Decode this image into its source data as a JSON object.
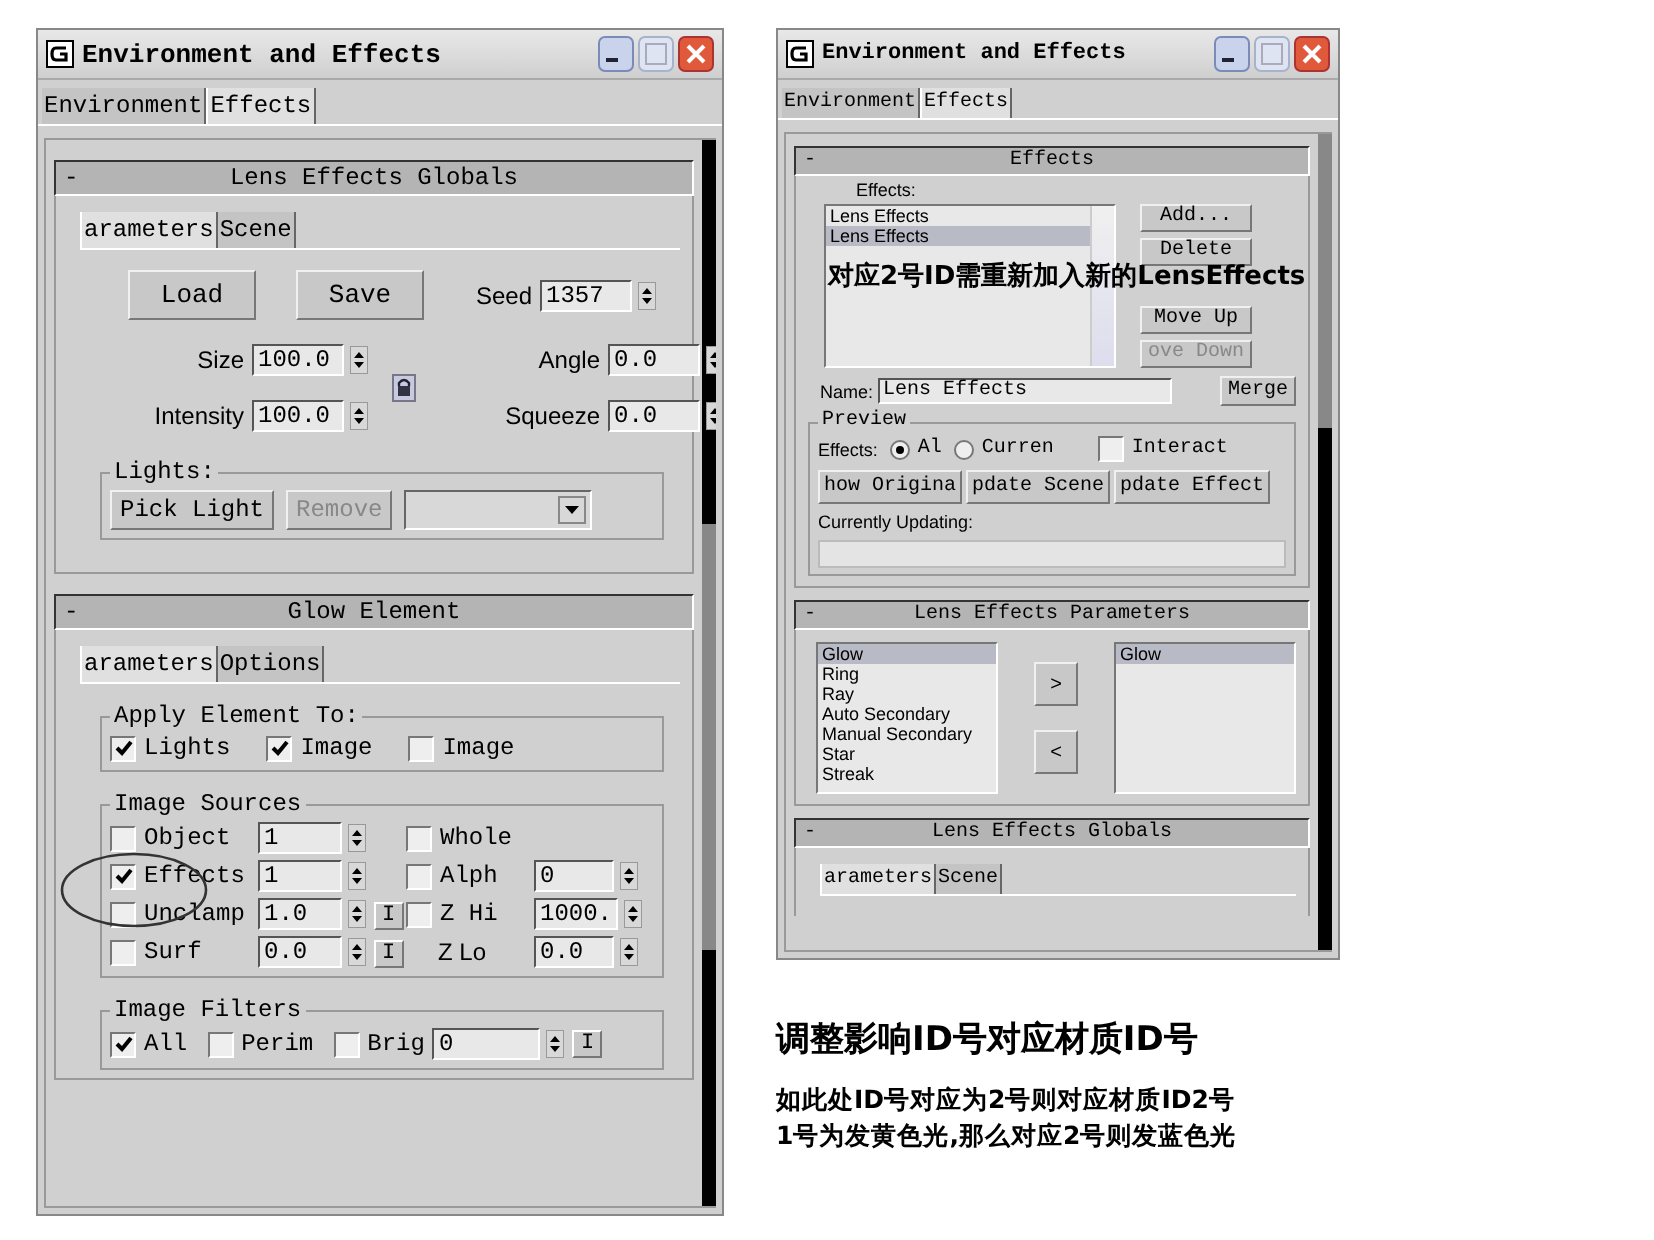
{
  "left_window": {
    "title": "Environment and Effects",
    "tabs": [
      {
        "label": "Environment",
        "selected": false
      },
      {
        "label": "Effects",
        "selected": true
      }
    ],
    "globals": {
      "toggle": "-",
      "title": "Lens Effects Globals",
      "tabs": [
        {
          "label": "arameters",
          "selected": true
        },
        {
          "label": "Scene",
          "selected": false
        }
      ],
      "load_button": "Load",
      "save_button": "Save",
      "seed": {
        "label": "Seed",
        "value": "1357"
      },
      "size": {
        "label": "Size",
        "value": "100.0"
      },
      "angle": {
        "label": "Angle",
        "value": "0.0"
      },
      "intensity": {
        "label": "Intensity",
        "value": "100.0"
      },
      "squeeze": {
        "label": "Squeeze",
        "value": "0.0"
      },
      "lights": {
        "title": "Lights:",
        "pick_button": "Pick Light",
        "remove_button": {
          "label": "Remove",
          "disabled": true
        }
      }
    },
    "glow": {
      "toggle": "-",
      "title": "Glow Element",
      "tabs": [
        {
          "label": "arameters",
          "selected": true
        },
        {
          "label": "Options",
          "selected": false
        }
      ],
      "apply": {
        "title": "Apply Element To:",
        "options": [
          {
            "label": "Lights",
            "checked": true
          },
          {
            "label": "Image",
            "checked": true
          },
          {
            "label": "Image",
            "checked": false
          }
        ]
      },
      "sources": {
        "title": "Image Sources",
        "rows": [
          {
            "label": "Object",
            "checked": false,
            "value": "1",
            "right": {
              "kind": "check",
              "label": "Whole",
              "checked": false
            }
          },
          {
            "label": "Effects",
            "checked": true,
            "value": "1",
            "right": {
              "kind": "check",
              "label": "Alph",
              "checked": false,
              "value": "0"
            }
          },
          {
            "label": "Unclamp",
            "checked": false,
            "value": "1.0",
            "i_button": "I",
            "right": {
              "kind": "check",
              "label": "Z Hi",
              "checked": false,
              "value": "1000."
            }
          },
          {
            "label": "Surf",
            "checked": false,
            "value": "0.0",
            "i_button": "I",
            "right": {
              "kind": "label",
              "label": "Z Lo",
              "value": "0.0"
            }
          }
        ]
      },
      "filters": {
        "title": "Image Filters",
        "options": [
          {
            "label": "All",
            "checked": true
          },
          {
            "label": "Perim",
            "checked": false
          },
          {
            "label": "Brig",
            "checked": false,
            "value": "0",
            "i_button": "I"
          }
        ]
      }
    }
  },
  "right_window": {
    "title": "Environment and Effects",
    "tabs": [
      {
        "label": "Environment",
        "selected": false
      },
      {
        "label": "Effects",
        "selected": true
      }
    ],
    "effects": {
      "toggle": "-",
      "title": "Effects",
      "list_label": "Effects:",
      "items": [
        {
          "label": "Lens Effects",
          "selected": false
        },
        {
          "label": "Lens Effects",
          "selected": true
        }
      ],
      "buttons": [
        {
          "label": "Add...",
          "disabled": false
        },
        {
          "label": "Delete",
          "disabled": false
        },
        {
          "label": "Move Up",
          "disabled": false
        },
        {
          "label": "ove Down",
          "disabled": true
        }
      ],
      "name_label": "Name:",
      "name_value": "Lens Effects",
      "merge_button": "Merge",
      "preview": {
        "title": "Preview",
        "effects_label": "Effects:",
        "radios": [
          {
            "label": "Al",
            "selected": true
          },
          {
            "label": "Curren",
            "selected": false
          }
        ],
        "interact": {
          "label": "Interact",
          "checked": false
        },
        "buttons": [
          "how Origina",
          "pdate Scene",
          "pdate Effect"
        ],
        "updating_label": "Currently Updating:",
        "progress": {
          "level": 0
        }
      }
    },
    "parameters": {
      "toggle": "-",
      "title": "Lens Effects Parameters",
      "available": [
        {
          "label": "Glow",
          "selected": true
        },
        {
          "label": "Ring",
          "selected": false
        },
        {
          "label": "Ray",
          "selected": false
        },
        {
          "label": "Auto Secondary",
          "selected": false
        },
        {
          "label": "Manual Secondary",
          "selected": false
        },
        {
          "label": "Star",
          "selected": false
        },
        {
          "label": "Streak",
          "selected": false
        }
      ],
      "add_button": ">",
      "remove_button": "<",
      "active": [
        {
          "label": "Glow",
          "selected": true
        }
      ]
    },
    "globals": {
      "toggle": "-",
      "title": "Lens Effects Globals",
      "tabs": [
        {
          "label": "arameters",
          "selected": true
        },
        {
          "label": "Scene",
          "selected": false
        }
      ]
    },
    "annotation": "对应2号ID需重新加入新的LensEffects"
  },
  "caption": {
    "heading": "调整影响ID号对应材质ID号",
    "lines": [
      "如此处ID号对应为2号则对应材质ID2号",
      "1号为发黄色光,那么对应2号则发蓝色光"
    ]
  }
}
